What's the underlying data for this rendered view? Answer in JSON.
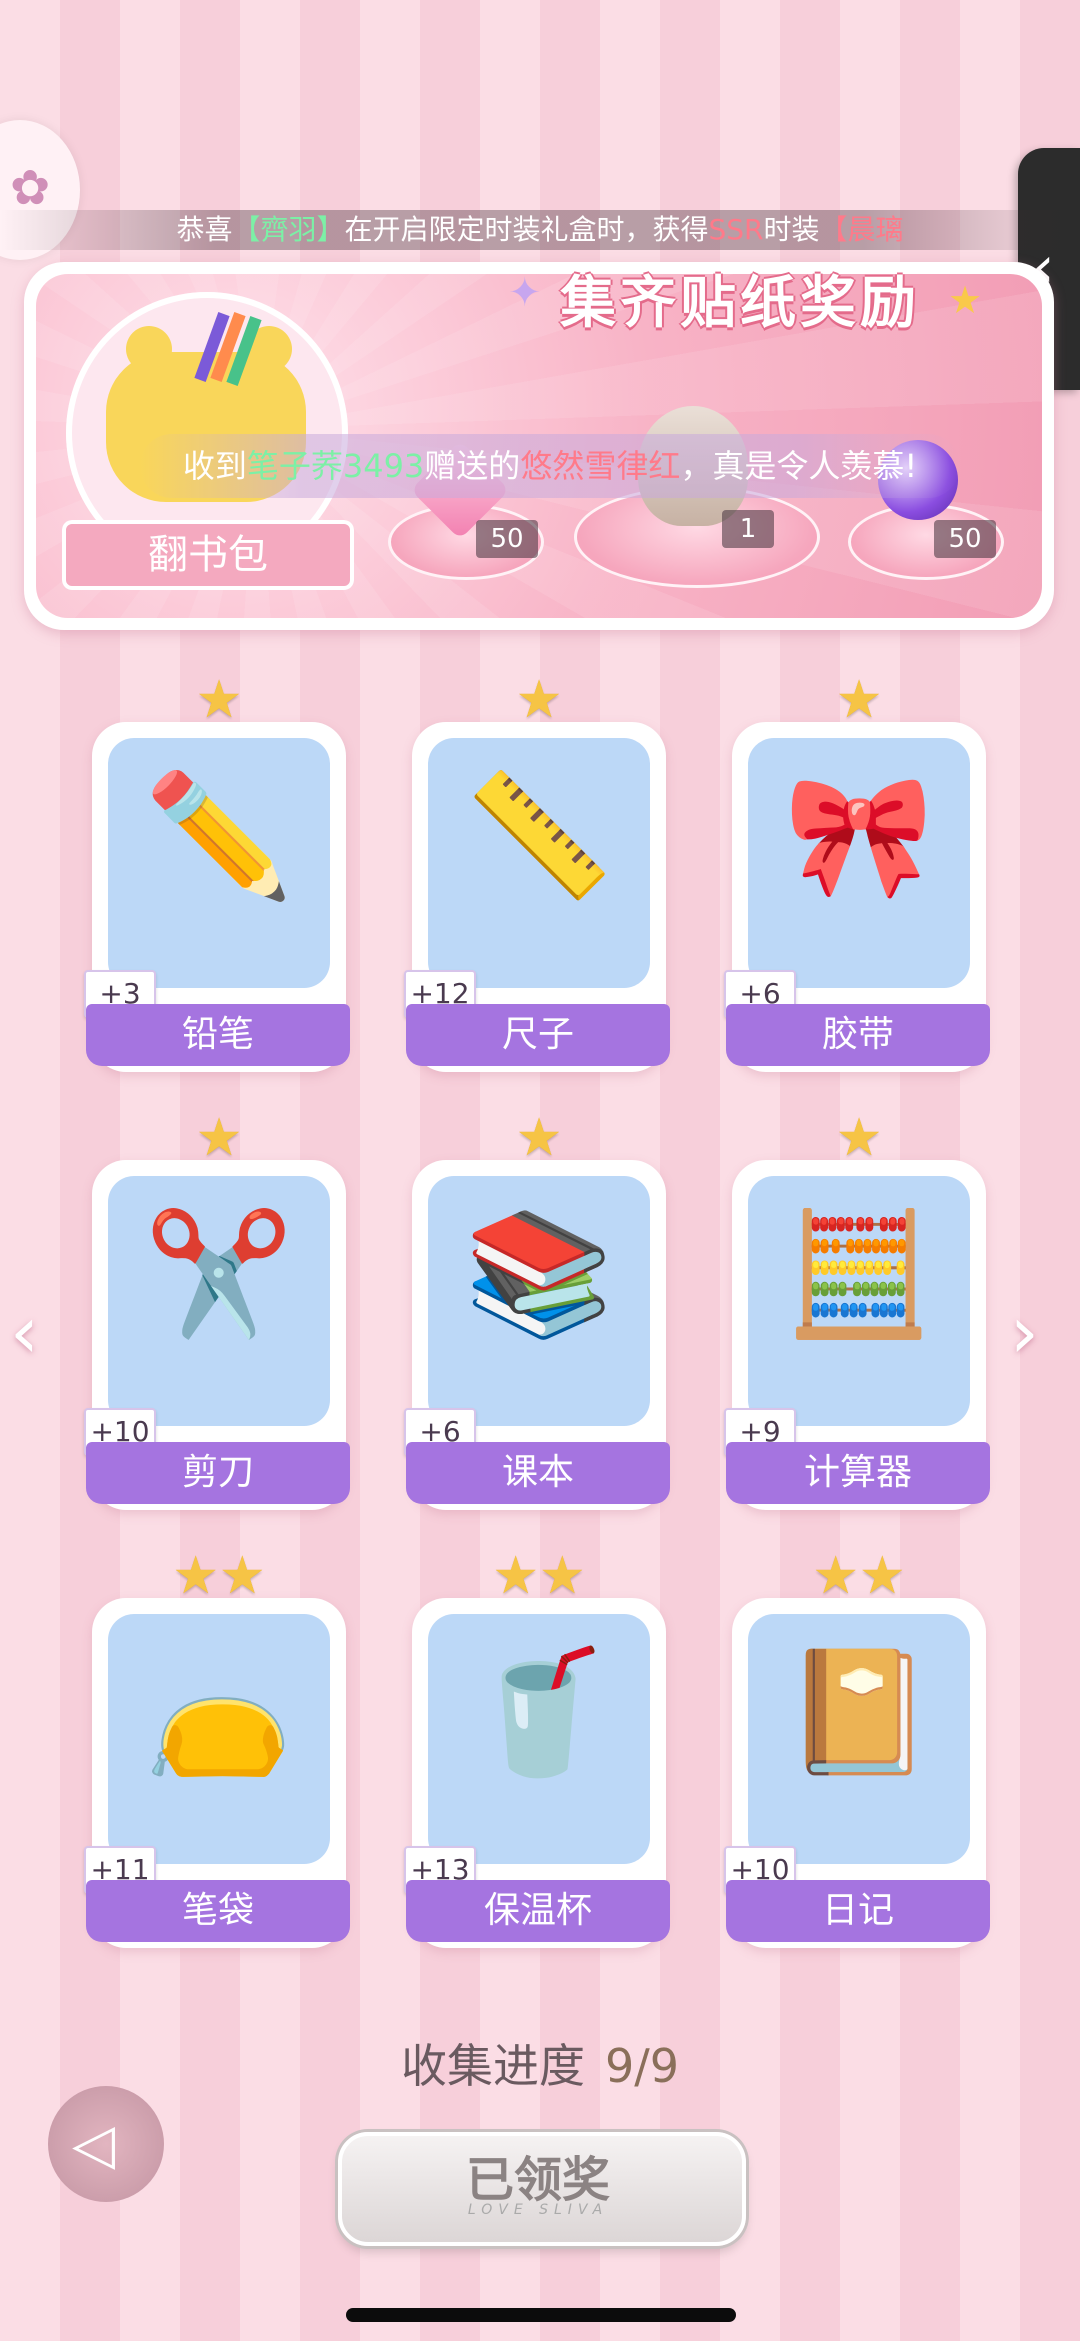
{
  "ticker": {
    "prefix": "恭喜",
    "player": "【齊羽】",
    "middle": "在开启限定时装礼盒时，获得",
    "rarity": "SSR",
    "suffix": "时装",
    "item": "【晨璃"
  },
  "banner": {
    "title": "集齐贴纸奖励",
    "book_button": "翻书包",
    "message_prefix": "收到",
    "message_sender": "笔子荞3493",
    "message_middle": "赠送的",
    "message_gift": "悠然雪律红",
    "message_suffix": "，真是令人羡慕!",
    "rewards": [
      {
        "icon": "pink-gem-icon",
        "count": "50"
      },
      {
        "icon": "outfit-figure-icon",
        "count": "1"
      },
      {
        "icon": "purple-orb-icon",
        "count": "50"
      }
    ]
  },
  "cards": [
    {
      "label": "铅笔",
      "plus": "+3",
      "stars": "★",
      "icon": "✏️"
    },
    {
      "label": "尺子",
      "plus": "+12",
      "stars": "★",
      "icon": "📏"
    },
    {
      "label": "胶带",
      "plus": "+6",
      "stars": "★",
      "icon": "🎀"
    },
    {
      "label": "剪刀",
      "plus": "+10",
      "stars": "★",
      "icon": "✂️"
    },
    {
      "label": "课本",
      "plus": "+6",
      "stars": "★",
      "icon": "📚"
    },
    {
      "label": "计算器",
      "plus": "+9",
      "stars": "★",
      "icon": "🧮"
    },
    {
      "label": "笔袋",
      "plus": "+11",
      "stars": "★★",
      "icon": "👝"
    },
    {
      "label": "保温杯",
      "plus": "+13",
      "stars": "★★",
      "icon": "🥤"
    },
    {
      "label": "日记",
      "plus": "+10",
      "stars": "★★",
      "icon": "📔"
    }
  ],
  "progress": {
    "label": "收集进度",
    "value": "9/9"
  },
  "claimed_button": {
    "label": "已领奖",
    "sub": "LOVE SLIVA"
  },
  "colors": {
    "card_label_bg": "#a574e0",
    "card_image_bg": "#bcd8f7",
    "star": "#f6c445",
    "title_stroke": "#e46b8b"
  }
}
